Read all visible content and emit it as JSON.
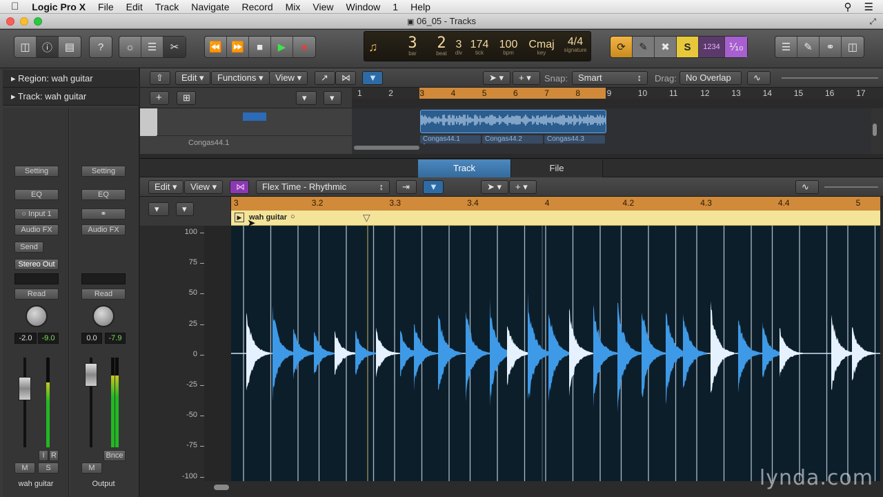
{
  "menubar": {
    "app": "Logic Pro X",
    "items": [
      "File",
      "Edit",
      "Track",
      "Navigate",
      "Record",
      "Mix",
      "View",
      "Window",
      "1",
      "Help"
    ]
  },
  "window": {
    "title": "06_05 - Tracks"
  },
  "lcd": {
    "bar": "3",
    "bar_label": "bar",
    "beat": "2",
    "beat_label": "beat",
    "div": "3",
    "div_label": "div",
    "tick": "174",
    "tick_label": "tick",
    "bpm": "100",
    "bpm_label": "bpm",
    "key": "Cmaj",
    "key_label": "key",
    "signature": "4/4",
    "signature_label": "signature"
  },
  "toolbar_right": {
    "cycle_count": "1234"
  },
  "inspector": {
    "region": "Region: wah guitar",
    "track": "Track: wah guitar",
    "strip1": {
      "setting": "Setting",
      "eq": "EQ",
      "input": "Input 1",
      "audiofx": "Audio FX",
      "send": "Send",
      "output": "Stereo Out",
      "automation": "Read",
      "pan": "-2.0",
      "peak": "-9.0",
      "m": "M",
      "s": "S",
      "i": "I",
      "r": "R",
      "name": "wah guitar",
      "level": 0.72
    },
    "strip2": {
      "setting": "Setting",
      "eq": "EQ",
      "audiofx": "Audio FX",
      "automation": "Read",
      "pan": "0.0",
      "peak": "-7.9",
      "bnce": "Bnce",
      "m": "M",
      "name": "Output",
      "level": 0.8
    }
  },
  "tracks_area": {
    "menus": {
      "edit": "Edit",
      "functions": "Functions",
      "view": "View"
    },
    "snap_label": "Snap:",
    "snap_value": "Smart",
    "drag_label": "Drag:",
    "drag_value": "No Overlap",
    "ruler": [
      "1",
      "2",
      "3",
      "4",
      "5",
      "6",
      "7",
      "8",
      "9",
      "10",
      "11",
      "12",
      "13",
      "14",
      "15",
      "16",
      "17"
    ],
    "region_names": [
      "Congas44.1",
      "Congas44.2",
      "Congas44.3"
    ],
    "track_name_partial": "Congas44.1"
  },
  "editor": {
    "tabs": [
      "Track",
      "File"
    ],
    "menus": {
      "edit": "Edit",
      "view": "View"
    },
    "flex_mode": "Flex Time - Rhythmic",
    "ruler": [
      "3",
      "3.2",
      "3.3",
      "3.4",
      "4",
      "4.2",
      "4.3",
      "4.4",
      "5"
    ],
    "region_name": "wah guitar",
    "y_labels": [
      "100",
      "75",
      "50",
      "25",
      "0",
      "-25",
      "-50",
      "-75",
      "-100"
    ]
  },
  "watermark": "lynda.com",
  "colors": {
    "accent_blue": "#3a8bd6",
    "ruler_orange": "#d08a3a",
    "region_yellow": "#f3e49a",
    "wave_light": "#dfeeff",
    "wave_blue": "#3e9ae6"
  }
}
